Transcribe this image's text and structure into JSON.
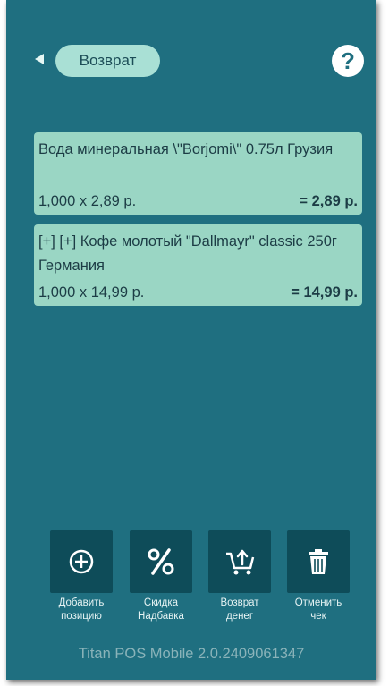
{
  "header": {
    "title": "Возврат",
    "help_label": "?"
  },
  "items": [
    {
      "name": "Вода минеральная \\\"Borjomi\\\" 0.75л Грузия",
      "qty_price": "1,000 x 2,89 р.",
      "total": "= 2,89 р."
    },
    {
      "name": "[+] [+] Кофе молотый \"Dallmayr\" classic 250г Германия",
      "qty_price": "1,000 x 14,99 р.",
      "total": "= 14,99 р."
    }
  ],
  "actions": [
    {
      "icon": "plus-circle-icon",
      "line1": "Добавить",
      "line2": "позицию"
    },
    {
      "icon": "percent-icon",
      "line1": "Скидка",
      "line2": "Надбавка"
    },
    {
      "icon": "cart-return-icon",
      "line1": "Возврат",
      "line2": "денег"
    },
    {
      "icon": "trash-icon",
      "line1": "Отменить",
      "line2": "чек"
    }
  ],
  "footer": {
    "version_text": "Titan POS Mobile 2.0.2409061347"
  },
  "colors": {
    "background": "#1f6f80",
    "card": "#9ad6c4",
    "button": "#0e4c59",
    "pill": "#a9e0d5"
  }
}
